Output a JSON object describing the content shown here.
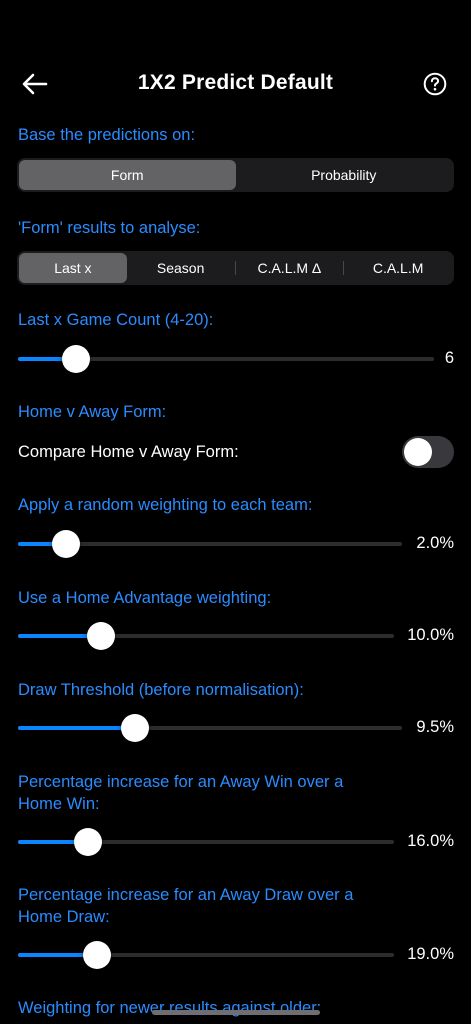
{
  "header": {
    "title": "1X2 Predict Default",
    "back_icon": "arrow-left-icon",
    "help_icon": "question-circle-icon"
  },
  "prediction_basis": {
    "label": "Base the predictions on:",
    "options": [
      "Form",
      "Probability"
    ],
    "selected": "Form"
  },
  "form_results": {
    "label": "'Form' results to analyse:",
    "options": [
      "Last x",
      "Season",
      "C.A.L.M Δ",
      "C.A.L.M"
    ],
    "selected": "Last x"
  },
  "game_count": {
    "label": "Last x Game Count (4-20):",
    "value": "6",
    "level": 0.14
  },
  "home_away": {
    "label": "Home v Away Form:",
    "toggle_label": "Compare Home v Away Form:",
    "enabled": false
  },
  "random_weighting": {
    "label": "Apply a random weighting to each team:",
    "value": "2.0%",
    "level": 0.125
  },
  "home_advantage": {
    "label": "Use a Home Advantage weighting:",
    "value": "10.0%",
    "level": 0.22
  },
  "draw_threshold": {
    "label": "Draw Threshold (before normalisation):",
    "value": "9.5%",
    "level": 0.305
  },
  "away_win_increase": {
    "label_line1": "Percentage increase for an Away Win over a",
    "label_line2": "Home Win:",
    "value": "16.0%",
    "level": 0.185
  },
  "away_draw_increase": {
    "label_line1": "Percentage increase for an Away Draw over a",
    "label_line2": "Home Draw:",
    "value": "19.0%",
    "level": 0.21
  },
  "newer_results": {
    "label": "Weighting for newer results against older:"
  },
  "colors": {
    "accent": "#0a84ff",
    "label_blue": "#2a8cff",
    "background": "#000000"
  }
}
